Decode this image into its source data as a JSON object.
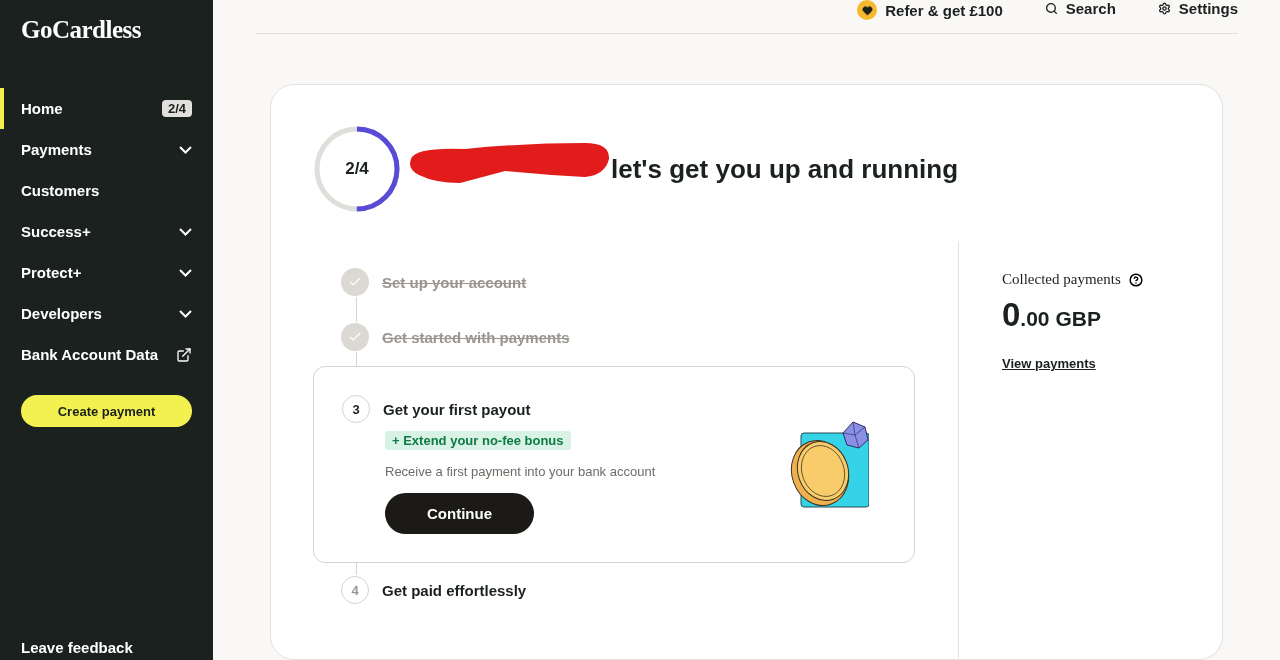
{
  "sidebar": {
    "logo": "GoCardless",
    "items": [
      {
        "label": "Home",
        "kind": "badge",
        "badge": "2/4",
        "selected": true
      },
      {
        "label": "Payments",
        "kind": "expand",
        "selected": false
      },
      {
        "label": "Customers",
        "kind": "plain",
        "selected": false
      },
      {
        "label": "Success+",
        "kind": "expand",
        "selected": false
      },
      {
        "label": "Protect+",
        "kind": "expand",
        "selected": false
      },
      {
        "label": "Developers",
        "kind": "expand",
        "selected": false
      },
      {
        "label": "Bank Account Data",
        "kind": "external",
        "selected": false
      }
    ],
    "create_button": "Create payment",
    "feedback": "Leave feedback"
  },
  "topbar": [
    {
      "label": "Refer & get £100",
      "kind": "refer"
    },
    {
      "label": "Search",
      "kind": "search"
    },
    {
      "label": "Settings",
      "kind": "settings"
    }
  ],
  "progress": {
    "text": "2/4"
  },
  "heading": "let's get you up and running",
  "steps": [
    {
      "label": "Set up your account",
      "done": true,
      "active": false
    },
    {
      "label": "Get started with payments",
      "done": true,
      "active": false
    },
    {
      "number": "3",
      "label": "Get your first payout",
      "done": false,
      "active": true,
      "badge": "+ Extend your no-fee bonus",
      "description": "Receive a first payment into your bank account",
      "button": "Continue"
    },
    {
      "number": "4",
      "label": "Get paid effortlessly",
      "done": false,
      "active": false
    }
  ],
  "summary": {
    "label": "Collected payments",
    "amount_whole": "0",
    "amount_rest": ".00 GBP",
    "link": "View payments"
  }
}
